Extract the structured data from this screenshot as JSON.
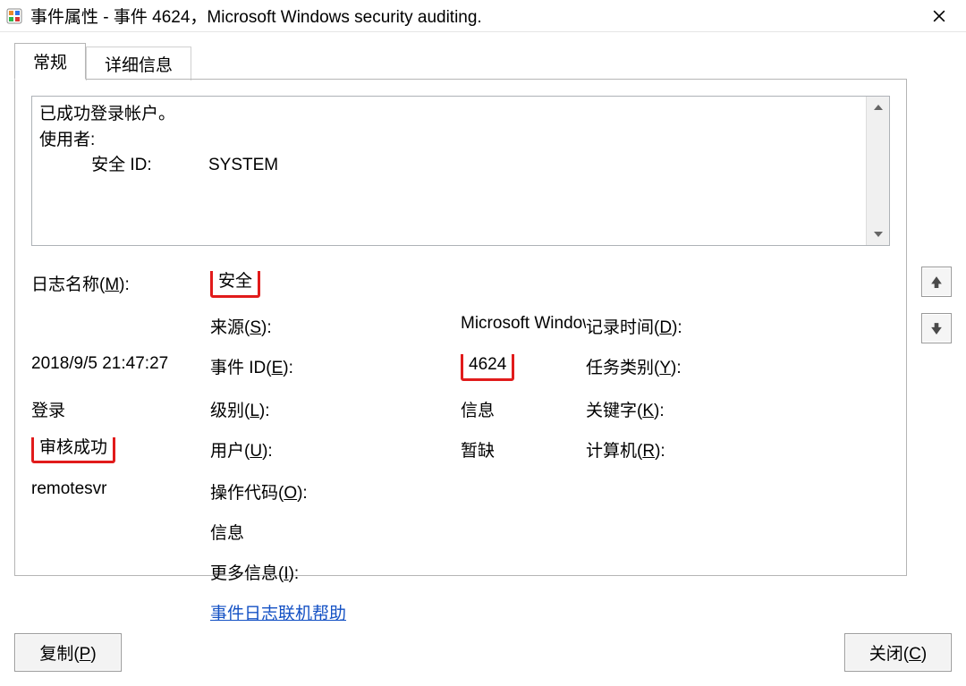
{
  "window": {
    "title": "事件属性 - 事件 4624，Microsoft Windows security auditing."
  },
  "tabs": {
    "general": "常规",
    "details": "详细信息"
  },
  "description": {
    "line1": "已成功登录帐户。",
    "blank": "",
    "line2": "使用者:",
    "line3_label": "安全 ID:",
    "line3_value": "SYSTEM"
  },
  "fields": {
    "log_name": {
      "label_pre": "日志名称(",
      "ak": "M",
      "label_post": "):",
      "value": "安全"
    },
    "source": {
      "label_pre": "来源(",
      "ak": "S",
      "label_post": "):",
      "value": "Microsoft Windows secur"
    },
    "logged": {
      "label_pre": "记录时间(",
      "ak": "D",
      "label_post": "):",
      "value": "2018/9/5 21:47:27"
    },
    "event_id": {
      "label_pre": "事件 ID(",
      "ak": "E",
      "label_post": "):",
      "value": "4624"
    },
    "task_cat": {
      "label_pre": "任务类别(",
      "ak": "Y",
      "label_post": "):",
      "value": "登录"
    },
    "level": {
      "label_pre": "级别(",
      "ak": "L",
      "label_post": "):",
      "value": "信息"
    },
    "keywords": {
      "label_pre": "关键字(",
      "ak": "K",
      "label_post": "):",
      "value": "审核成功"
    },
    "user": {
      "label_pre": "用户(",
      "ak": "U",
      "label_post": "):",
      "value": "暂缺"
    },
    "computer": {
      "label_pre": "计算机(",
      "ak": "R",
      "label_post": "):",
      "value": "remotesvr"
    },
    "opcode": {
      "label_pre": "操作代码(",
      "ak": "O",
      "label_post": "):",
      "value": "信息"
    },
    "more_info": {
      "label_pre": "更多信息(",
      "ak": "I",
      "label_post": "):",
      "value": "事件日志联机帮助"
    }
  },
  "buttons": {
    "copy": {
      "pre": "复制(",
      "ak": "P",
      "post": ")"
    },
    "close": {
      "pre": "关闭(",
      "ak": "C",
      "post": ")"
    }
  }
}
